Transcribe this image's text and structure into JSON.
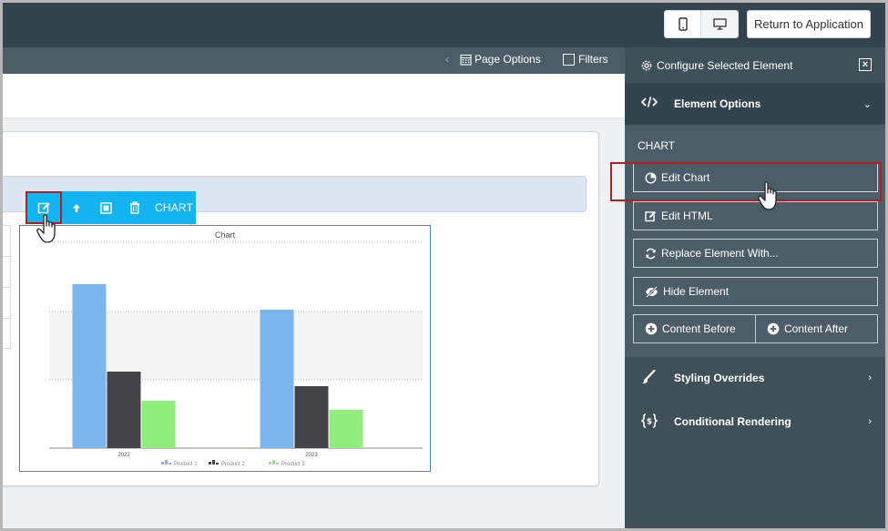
{
  "header": {
    "return_label": "Return to Application",
    "mobile_icon": "mobile-icon",
    "desktop_icon": "desktop-icon"
  },
  "subbar": {
    "page_options_label": "Page Options",
    "filters_label": "Filters"
  },
  "toolbar": {
    "element_type_label": "CHART",
    "icons": [
      "edit-icon",
      "arrow-up-icon",
      "select-parent-icon",
      "trash-icon"
    ]
  },
  "chart_data": {
    "type": "bar",
    "title": "Chart",
    "categories": [
      "2022",
      "2023"
    ],
    "series": [
      {
        "name": "Product 1",
        "values": [
          90,
          76
        ],
        "color": "#7cb5ec"
      },
      {
        "name": "Product 2",
        "values": [
          42,
          34
        ],
        "color": "#434348"
      },
      {
        "name": "Product 3",
        "values": [
          26,
          21
        ],
        "color": "#90ed7d"
      }
    ],
    "ylim": [
      0,
      113
    ],
    "legend": "bottom",
    "grid": true
  },
  "panel": {
    "title": "Configure Selected Element",
    "element_options_label": "Element Options",
    "section_label": "CHART",
    "buttons": {
      "edit_chart": "Edit Chart",
      "edit_html": "Edit HTML",
      "replace": "Replace Element With...",
      "hide": "Hide Element",
      "content_before": "Content Before",
      "content_after": "Content After"
    },
    "styling_label": "Styling Overrides",
    "conditional_label": "Conditional Rendering"
  }
}
